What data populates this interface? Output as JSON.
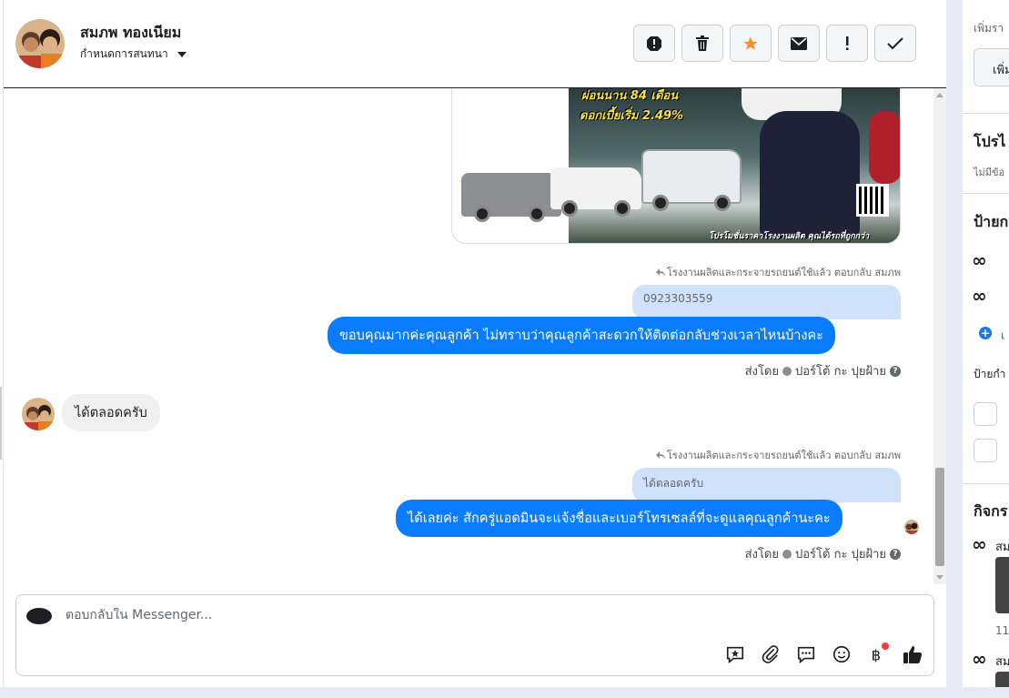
{
  "header": {
    "contact_name": "สมภพ ทองเนียม",
    "assign_label": "กำหนดการสนทนา",
    "actions": [
      {
        "icon": "spam-icon",
        "name": "mark-spam-button"
      },
      {
        "icon": "trash-icon",
        "name": "delete-button"
      },
      {
        "icon": "star-icon",
        "name": "star-button"
      },
      {
        "icon": "mail-icon",
        "name": "mark-unread-button"
      },
      {
        "icon": "exclamation-icon",
        "name": "follow-up-button"
      },
      {
        "icon": "check-icon",
        "name": "mark-done-button"
      }
    ]
  },
  "ad": {
    "headline1": "ผ่อนนาน 84 เดือน",
    "headline2": "ดอกเบี้ยเริ่ม 2.49%",
    "footer": "โปรโมชั่นราคาโรงงานผลิต คุณได้รถที่ถูกกว่า"
  },
  "messages": [
    {
      "ref": "โรงงานผลิตและกระจายรถยนต์ใช้แล้ว ตอบกลับ สมภพ",
      "quote": "0923303559",
      "text": "ขอบคุณมากค่ะคุณลูกค้า ไม่ทราบว่าคุณลูกค้าสะดวกให้ติดต่อกลับช่วงเวลาไหนบ้างคะ",
      "sent_by_label": "ส่งโดย",
      "sent_by_name": "ปอร์โต้ กะ ปุยฝ้าย"
    },
    {
      "incoming_text": "ได้ตลอดครับ"
    },
    {
      "ref": "โรงงานผลิตและกระจายรถยนต์ใช้แล้ว ตอบกลับ สมภพ",
      "quote": "ได้ตลอดครับ",
      "text": "ได้เลยค่ะ สักครู่แอดมินจะแจ้งชื่อและเบอร์โทรเซลล์ที่จะดูแลคุณลูกค้านะคะ",
      "sent_by_label": "ส่งโดย",
      "sent_by_name": "ปอร์โต้ กะ ปุยฝ้าย"
    }
  ],
  "composer": {
    "placeholder": "ตอบกลับใน Messenger...",
    "tools": [
      "saved-reply-icon",
      "attachment-icon",
      "chat-icon",
      "emoji-icon",
      "baht-icon",
      "thumbs-up-icon"
    ]
  },
  "right_panel": {
    "add_hint": "เพิ่มรา",
    "add_button": "เพิ่ม",
    "profile_title": "โปรไ",
    "profile_empty": "ไม่มีข้อ",
    "labels_title": "ป้ายก",
    "add_label_text": "เ",
    "labels_sub": "ป้ายกำ",
    "activity_title": "กิจกร",
    "activity_author_1": "สม",
    "activity_time": "11",
    "activity_author_2": "สม"
  },
  "colors": {
    "accent": "#0a7cff",
    "quote_bg": "#cfe1fb",
    "incoming_bg": "#f0f0f0",
    "star": "#f7923b",
    "background": "#e4ebf5"
  }
}
